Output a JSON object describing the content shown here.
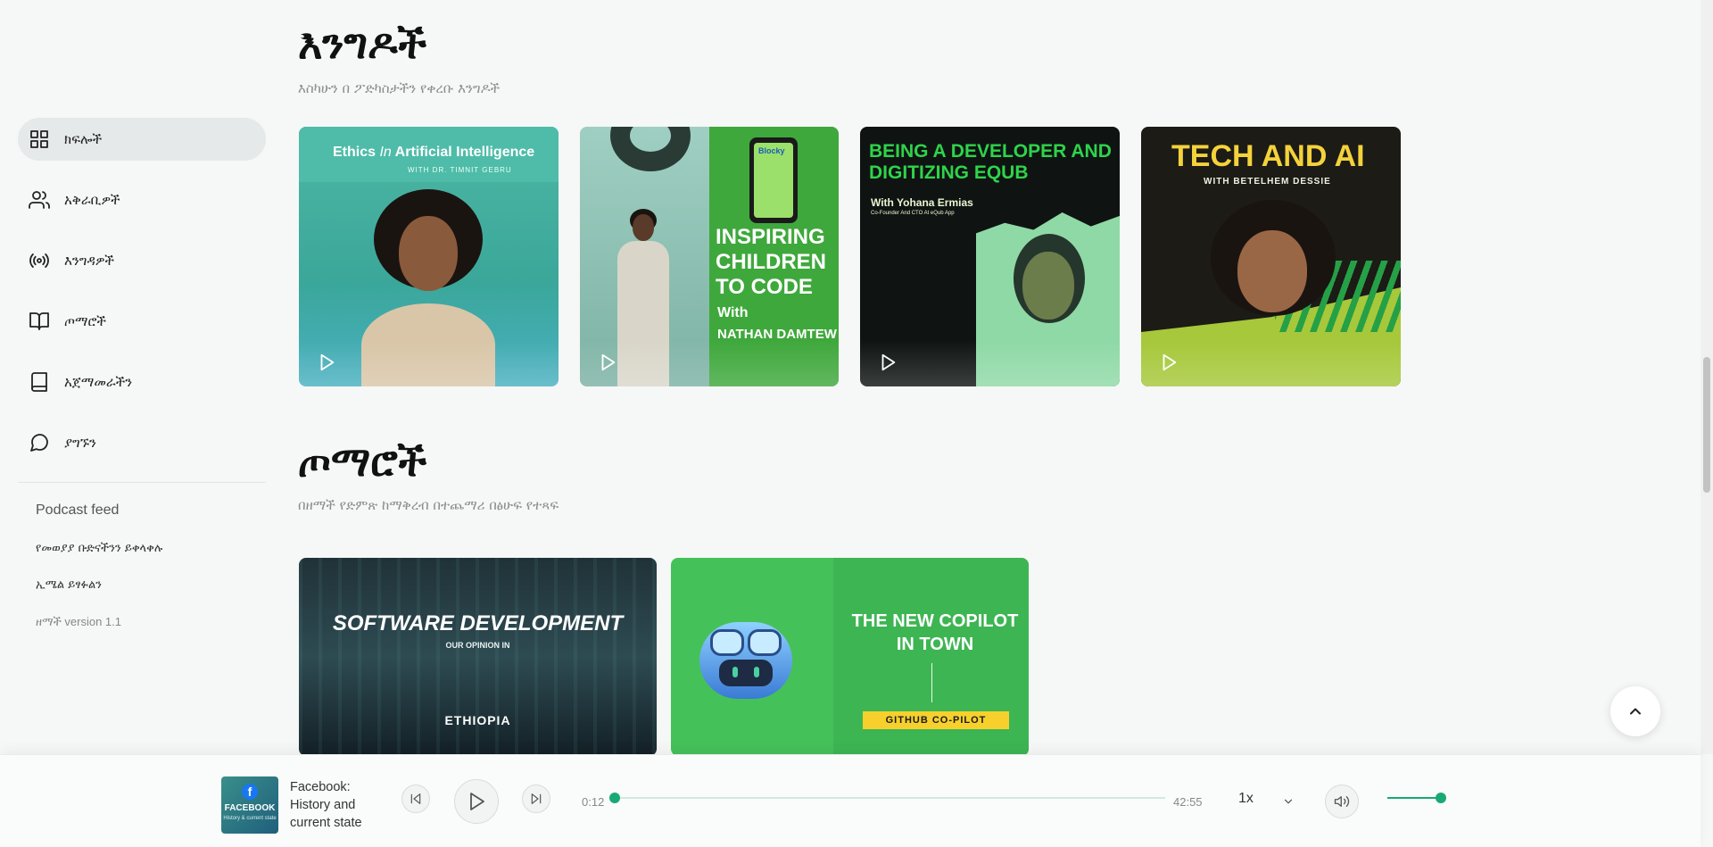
{
  "sidebar": {
    "items": [
      {
        "label": "ክፍሎች",
        "icon": "grid-icon",
        "active": true
      },
      {
        "label": "አቅራቢዎች",
        "icon": "users-icon",
        "active": false
      },
      {
        "label": "እንግዳዎች",
        "icon": "radio-icon",
        "active": false
      },
      {
        "label": "ጦማሮች",
        "icon": "book-open-icon",
        "active": false
      },
      {
        "label": "አጀማመራችን",
        "icon": "book-icon",
        "active": false
      },
      {
        "label": "ያግኙን",
        "icon": "message-circle-icon",
        "active": false
      }
    ],
    "podcast_feed_heading": "Podcast feed",
    "links": [
      "የመወያያ ቡድናችንን ይቀላቀሉ",
      "ኢሜል ይፃፉልን"
    ],
    "version": "ዘማች version 1.1"
  },
  "guests_section": {
    "title": "እንግዶች",
    "subtitle": "እስካሁን በ ፖድካስታችን የቀረቡ እንግዶች",
    "cards": [
      {
        "title_a": "Ethics",
        "title_b": "In",
        "title_c": "Artificial Intelligence",
        "sub": "WITH DR. TIMNIT GEBRU"
      },
      {
        "title": "INSPIRING CHILDREN TO CODE",
        "with": "With",
        "name": "NATHAN DAMTEW",
        "app": "Blocky"
      },
      {
        "title": "BEING A DEVELOPER AND DIGITIZING EQUB",
        "with": "With Yohana Ermias",
        "sub": "Co-Founder And CTO At eQub App"
      },
      {
        "title": "TECH AND AI",
        "sub": "WITH BETELHEM DESSIE"
      }
    ]
  },
  "blogs_section": {
    "title": "ጦማሮች",
    "subtitle": "በዘማች የድምጽ ከማቅረብ በተጨማሪ በፅሁፍ የተጻፍ",
    "cards": [
      {
        "title": "SOFTWARE DEVELOPMENT",
        "sub": "OUR OPINION IN",
        "place": "ETHIOPIA"
      },
      {
        "title": "THE NEW COPILOT IN TOWN",
        "tag": "GITHUB CO-PILOT"
      }
    ]
  },
  "player": {
    "art_title": "FACEBOOK",
    "art_sub": "History & current state",
    "track_title": "Facebook: History and current state",
    "current_time": "0:12",
    "duration": "42:55",
    "progress": 0.005,
    "speed": "1x",
    "volume": 1.0,
    "accent": "#19a974"
  },
  "colors": {
    "accent": "#19a974",
    "background": "#f6f7f7",
    "active_nav": "#e6e9e9"
  }
}
